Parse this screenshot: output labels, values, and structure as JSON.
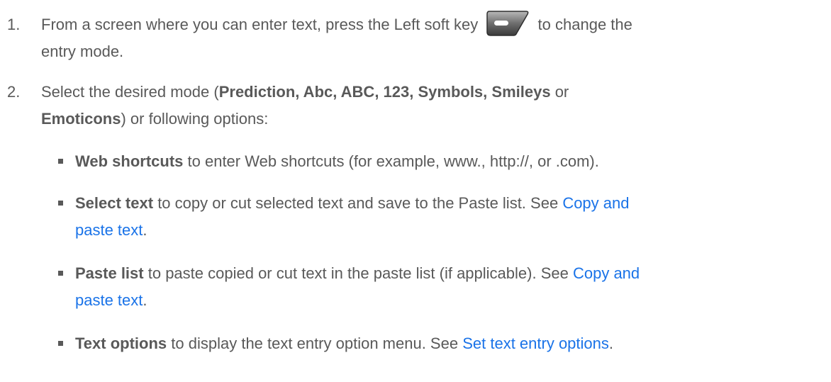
{
  "step1": {
    "num": "1.",
    "text_a": "From a screen where you can enter text, press the Left soft key",
    "text_b": "to change the",
    "text_c": "entry mode.",
    "key_icon": "left-soft-key-icon"
  },
  "step2": {
    "num": "2.",
    "text_a": "Select the desired mode (",
    "modes": "Prediction, Abc, ABC, 123, Symbols, Smileys",
    "text_or": "or",
    "mode_last": "Emoticons",
    "text_b": ") or following options:"
  },
  "bullets": [
    {
      "term": "Web shortcuts",
      "text": "to enter Web shortcuts (for example, www., http://, or .com)."
    },
    {
      "term": "Select text",
      "text": "to copy or cut selected text and save to the Paste list. See",
      "link_a": "Copy and",
      "link_b": "paste text",
      "end": "."
    },
    {
      "term": "Paste list",
      "text": "to paste copied or cut text in the paste list (if applicable). See",
      "link_a": "Copy and",
      "link_b": "paste text",
      "end": "."
    },
    {
      "term": "Text options",
      "text": "to display the text entry option menu. See",
      "link": "Set text entry options",
      "end": "."
    }
  ]
}
